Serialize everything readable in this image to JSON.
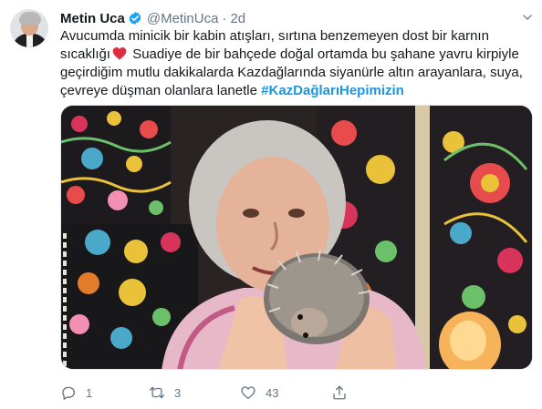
{
  "author": {
    "name": "Metin Uca",
    "handle": "@MetinUca",
    "separator": "·",
    "time": "2d"
  },
  "tweet": {
    "line1": "Avucumda minicik bir kabin atışları, sırtına benzemeyen dost bir karnın",
    "line2_before": "sıcaklığı",
    "line2_after": " Suadiye de bir bahçede doğal ortamda bu şahane yavru kirpiyle",
    "line3": "geçirdiğim mutlu dakikalarda Kazdağlarında siyanürle altın arayanlara, suya,",
    "line4_before": "çevreye düşman olanlara lanetle  ",
    "hashtag": "#KazDağlarıHepimizin"
  },
  "icons": {
    "verified": "verified-badge-icon",
    "heart": "red-heart-emoji-icon",
    "more": "chevron-down-icon",
    "reply": "reply-icon",
    "retweet": "retweet-icon",
    "like": "like-heart-icon",
    "share": "share-icon"
  },
  "actions": {
    "reply_count": "1",
    "retweet_count": "3",
    "like_count": "43"
  },
  "colors": {
    "accent": "#1b95e0",
    "verified": "#1da1f2",
    "heart": "#e0245e",
    "muted": "#657786"
  }
}
